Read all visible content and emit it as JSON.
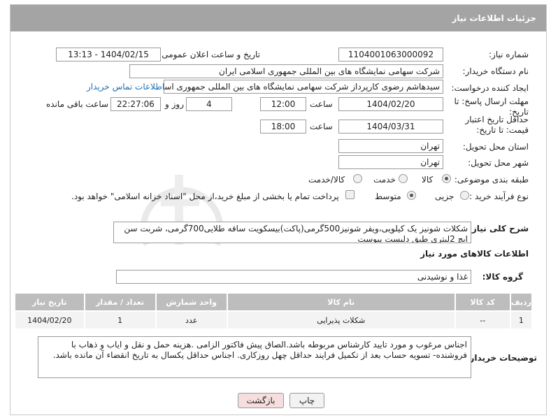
{
  "header": {
    "title": "جزئیات اطلاعات نیاز"
  },
  "form": {
    "need_number_label": "شماره نیاز:",
    "need_number": "1104001063000092",
    "announce_label": "تاریخ و ساعت اعلان عمومی:",
    "announce_value": "1404/02/15 - 13:13",
    "buyer_org_label": "نام دستگاه خریدار:",
    "buyer_org": "شرکت سهامی نمایشگاه های بین المللی جمهوری اسلامی ایران",
    "requester_label": "ایجاد کننده درخواست:",
    "requester": "سیدهاشم رضوی کارپرداز شرکت سهامی نمایشگاه های بین المللی جمهوری اسلامی",
    "contact_link": "اطلاعات تماس خریدار",
    "deadline_label": "مهلت ارسال پاسخ: تا تاریخ:",
    "deadline_date": "1404/02/20",
    "time_label": "ساعت",
    "deadline_time": "12:00",
    "days_value": "4",
    "days_label": "روز و",
    "remaining_time": "22:27:06",
    "remaining_label": "ساعت باقی مانده",
    "validity_label": "حداقل تاریخ اعتبار قیمت: تا تاریخ:",
    "validity_date": "1404/03/31",
    "validity_time": "18:00",
    "province_label": "استان محل تحویل:",
    "province": "تهران",
    "city_label": "شهر محل تحویل:",
    "city": "تهران",
    "category_label": "طبقه بندی موضوعی:",
    "category_options": [
      "کالا",
      "خدمت",
      "کالا/خدمت"
    ],
    "process_label": "نوع فرآیند خرید :",
    "process_options": [
      "جزیی",
      "متوسط"
    ],
    "payment_note": "پرداخت تمام یا بخشی از مبلغ خرید،از محل \"اسناد خزانه اسلامی\" خواهد بود.",
    "description_label": "شرح کلی نیاز:",
    "description": "شکلات شونیز یک کیلویی،ویفر شونیز500گرمی(پاکت)بیسکویت ساقه طلایی700گرمی، شربت سن ایچ 2لیتری طبق دلیست پیوست",
    "goods_info_title": "اطلاعات کالاهای مورد نیاز",
    "goods_group_label": "گروه کالا:",
    "goods_group": "غذا و نوشیدنی"
  },
  "table": {
    "headers": [
      "ردیف",
      "کد کالا",
      "نام کالا",
      "واحد شمارش",
      "تعداد / مقدار",
      "تاریخ نیاز"
    ],
    "rows": [
      [
        "1",
        "--",
        "شکلات پذیرایی",
        "عدد",
        "1",
        "1404/02/20"
      ]
    ]
  },
  "notes": {
    "label": "توضیحات خریدار:",
    "text": "اجناس مرغوب و مورد تایید کارشناس  مربوطه باشد.الصاق پیش فاکتور الزامی .هزینه حمل و نقل و ایاب و ذهاب با فروشنده- تسویه حساب بعد از تکمیل فرایند حداقل چهل روزکاری. اجناس حداقل یکسال به تاریخ انقضاء آن مانده باشد."
  },
  "buttons": {
    "print": "چاپ",
    "back": "بازگشت"
  },
  "colors": {
    "titlebar": "#a4a4a4",
    "link": "#1a6fb5",
    "back_button": "#f6dede"
  }
}
